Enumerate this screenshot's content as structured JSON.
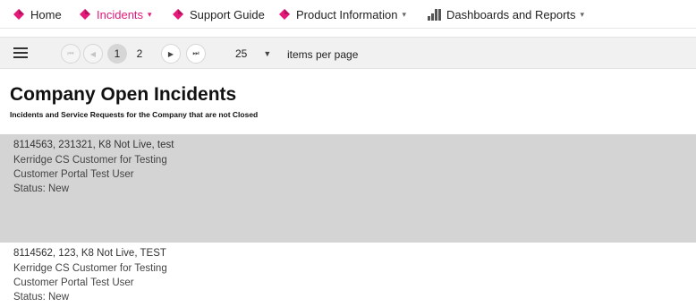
{
  "nav": {
    "home": "Home",
    "incidents": "Incidents",
    "support_guide": "Support Guide",
    "product_information": "Product Information",
    "dashboards_reports": "Dashboards and Reports",
    "caret": "▾",
    "accent_color": "#e5197a"
  },
  "toolbar": {
    "first_icon": "⏮",
    "prev_icon": "◀",
    "pages": [
      "1",
      "2"
    ],
    "current_page": "1",
    "next_icon": "▶",
    "last_icon": "⏭",
    "items_per_page_value": "25",
    "items_per_page_label": "items per page"
  },
  "page": {
    "title": "Company Open Incidents",
    "subtitle": "Incidents and Service Requests for the Company that are not Closed"
  },
  "records": [
    {
      "summary": "8114563, 231321, K8 Not Live, test",
      "company": "Kerridge CS Customer for Testing",
      "contact": "Customer Portal Test User",
      "status": "Status: New"
    },
    {
      "summary": "8114562, 123, K8 Not Live, TEST",
      "company": "Kerridge CS Customer for Testing",
      "contact": "Customer Portal Test User",
      "status": "Status: New"
    }
  ]
}
